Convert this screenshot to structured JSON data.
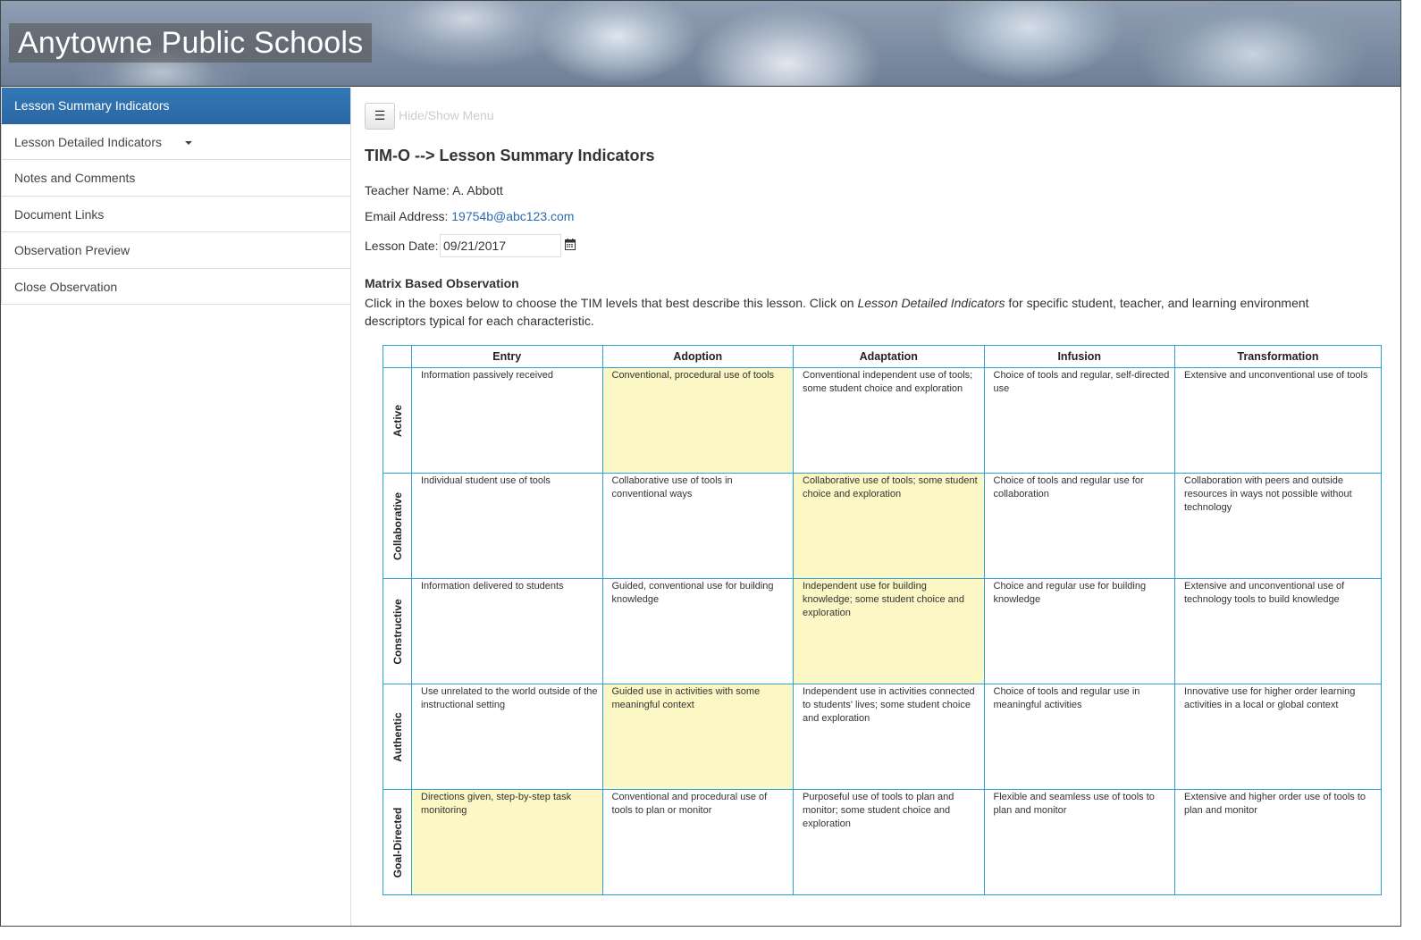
{
  "site": {
    "title": "Anytowne Public Schools"
  },
  "sidebar": {
    "items": [
      {
        "label": "Lesson Summary Indicators",
        "active": true
      },
      {
        "label": "Lesson Detailed Indicators",
        "dropdown": true
      },
      {
        "label": "Notes and Comments"
      },
      {
        "label": "Document Links"
      },
      {
        "label": "Observation Preview"
      },
      {
        "label": "Close Observation"
      }
    ]
  },
  "toolbar": {
    "menu_icon": "☰",
    "menu_label": "Hide/Show Menu"
  },
  "page": {
    "title": "TIM-O --> Lesson Summary Indicators",
    "teacher_label": "Teacher Name:",
    "teacher_value": "A. Abbott",
    "email_label": "Email Address:",
    "email_value": "19754b@abc123.com",
    "date_label": "Lesson Date:",
    "date_value": "09/21/2017"
  },
  "matrix_section": {
    "heading": "Matrix Based Observation",
    "instructions_before": "Click in the boxes below to choose the TIM levels that best describe this lesson. Click on ",
    "instructions_italic": "Lesson Detailed Indicators",
    "instructions_after": " for specific student, teacher, and learning environment descriptors typical for each characteristic."
  },
  "matrix": {
    "columns": [
      "Entry",
      "Adoption",
      "Adaptation",
      "Infusion",
      "Transformation"
    ],
    "rows": [
      {
        "label": "Active",
        "selected_col": 1,
        "cells": [
          "Information passively received",
          "Conventional, procedural use of tools",
          "Conventional independent use of tools; some student choice and exploration",
          "Choice of tools and regular, self-directed use",
          "Extensive and unconventional use of tools"
        ]
      },
      {
        "label": "Collaborative",
        "selected_col": 2,
        "cells": [
          "Individual student use of tools",
          "Collaborative use of tools in conventional ways",
          "Collaborative use of tools; some student choice and exploration",
          "Choice of tools and regular use for collaboration",
          "Collaboration with peers and outside resources in ways not possible without technology"
        ]
      },
      {
        "label": "Constructive",
        "selected_col": 2,
        "cells": [
          "Information delivered to students",
          "Guided, conventional use for building knowledge",
          "Independent use for building knowledge; some student choice and exploration",
          "Choice and regular use for building knowledge",
          "Extensive and unconventional use of technology tools to build knowledge"
        ]
      },
      {
        "label": "Authentic",
        "selected_col": 1,
        "cells": [
          "Use unrelated to the world outside of the instructional setting",
          "Guided use in activities with some meaningful context",
          "Independent use in activities connected to students' lives; some student choice and exploration",
          "Choice of tools and regular use in meaningful activities",
          "Innovative use for higher order learning activities in a local or global context"
        ]
      },
      {
        "label": "Goal-Directed",
        "selected_col": 0,
        "cells": [
          "Directions given, step-by-step task monitoring",
          "Conventional and procedural use of tools to plan or monitor",
          "Purposeful use of tools to plan and monitor; some student choice and exploration",
          "Flexible and seamless use of tools to plan and monitor",
          "Extensive and higher order use of tools to plan and monitor"
        ]
      }
    ]
  },
  "colors": {
    "accent": "#2f72b0",
    "selected_cell": "#fcf7c4",
    "grid": "#2aa0d8"
  }
}
